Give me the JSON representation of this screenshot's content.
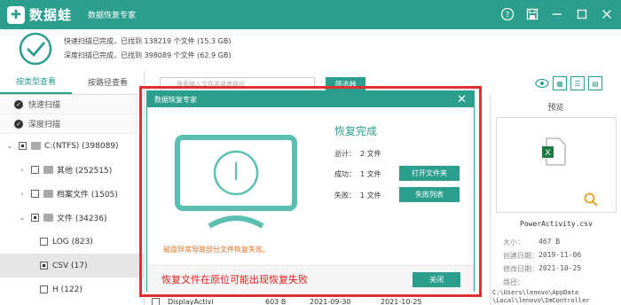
{
  "app": {
    "logo_glyph": "✚",
    "name": "数据蛙",
    "subtitle": "数据恢复专家"
  },
  "status": {
    "quick_scan": "快速扫描已完成，已找到 138219 个文件 (15.3 GB)",
    "deep_scan": "深度扫描已完成，已找到 398089 个文件 (62.9 GB)"
  },
  "left": {
    "tabs": [
      "按类型查看",
      "按路径查看"
    ],
    "scan_rows": [
      "快速扫描",
      "深度扫描"
    ],
    "tree": [
      {
        "label": "C:(NTFS) (398089)",
        "caret": "⌄"
      },
      {
        "label": "其他 (252515)",
        "caret": "›"
      },
      {
        "label": "档案文件 (1505)",
        "caret": "›"
      },
      {
        "label": "文件 (34236)",
        "caret": "⌄"
      },
      {
        "label": "LOG (823)",
        "caret": ""
      },
      {
        "label": "CSV (17)",
        "caret": ""
      },
      {
        "label": "H (122)",
        "caret": ""
      }
    ]
  },
  "toolbar": {
    "search_placeholder": "搜索输入文件名或者路径",
    "filter_label": "筛选器"
  },
  "preview": {
    "title": "预览",
    "filename": "PowerActivity.csv",
    "size_label": "大小：",
    "size_value": "467 B",
    "created_label": "创建日期：",
    "created_value": "2019-11-06",
    "modified_label": "修改日期：",
    "modified_value": "2021-10-25",
    "path_label": "路径：",
    "path_value": "C:\\Users\\lenovo\\AppData\n\\Local\\lenovo\\ImController"
  },
  "list_peek": {
    "name": "DisplayActivi",
    "size": "603 B",
    "created": "2021-09-30",
    "modified": "2021-10-25"
  },
  "dialog": {
    "title": "数据恢复专家",
    "heading": "恢复完成",
    "total_label": "总计：",
    "total_value": "2 文件",
    "success_label": "成功：",
    "success_value": "1 文件",
    "fail_label": "失败：",
    "fail_value": "1 文件",
    "open_folder": "打开文件夹",
    "fail_list": "失败列表",
    "warning": "磁盘异常导致部分文件恢复失败。",
    "close": "关闭"
  },
  "annotation": {
    "note": "恢复文件在原位可能出现恢复失败"
  },
  "colors": {
    "accent": "#2b9e8e",
    "warning": "#e07020",
    "annotation": "#e02020"
  }
}
